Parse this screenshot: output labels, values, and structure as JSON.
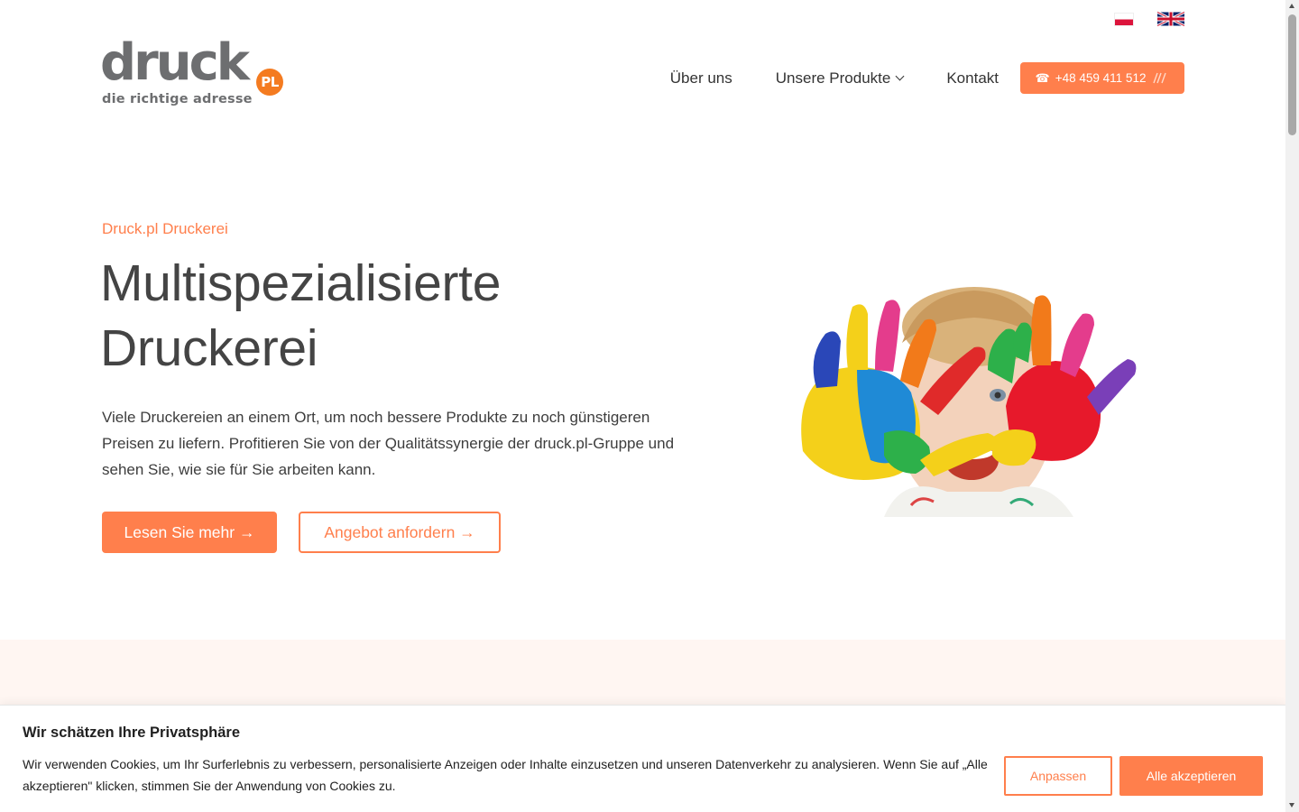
{
  "languages": [
    {
      "code": "pl",
      "label": "Polski",
      "icon": "poland-flag-icon"
    },
    {
      "code": "en",
      "label": "English",
      "icon": "uk-flag-icon"
    }
  ],
  "logo": {
    "word": "druck",
    "badge": "PL",
    "tagline": "die richtige adresse",
    "colors": {
      "text": "#6d6e70",
      "badge": "#f47b20"
    }
  },
  "nav": {
    "items": [
      {
        "label": "Über uns"
      },
      {
        "label": "Unsere Produkte",
        "has_dropdown": true
      },
      {
        "label": "Kontakt"
      }
    ],
    "phone_icon": "☎",
    "phone": "+48 459 411 512",
    "phone_signal_icon": "signal-waves-icon"
  },
  "hero": {
    "eyebrow": "Druck.pl Druckerei",
    "title_line1": "Multispezialisierte",
    "title_line2": "Druckerei",
    "text": "Viele Druckereien an einem Ort, um noch bessere Produkte zu noch günstigeren Preisen zu liefern. Profitieren Sie von der Qualitätssynergie der druck.pl-Gruppe und sehen Sie, wie sie für Sie arbeiten kann.",
    "primary_button": "Lesen Sie mehr →",
    "secondary_button": "Angebot anfordern →",
    "image_subject": "child-with-painted-hands-image"
  },
  "cookie": {
    "title": "Wir schätzen Ihre Privatsphäre",
    "text": "Wir verwenden Cookies, um Ihr Surferlebnis zu verbessern, personalisierte Anzeigen oder Inhalte einzusetzen und unseren Datenverkehr zu analysieren. Wenn Sie auf „Alle akzeptieren\" klicken, stimmen Sie der Anwendung von Cookies zu.",
    "customize_button": "Anpassen",
    "accept_button": "Alle akzeptieren"
  },
  "colors": {
    "accent": "#ff7f4c",
    "text": "#3d3d3d",
    "band": "#fff6f2"
  }
}
